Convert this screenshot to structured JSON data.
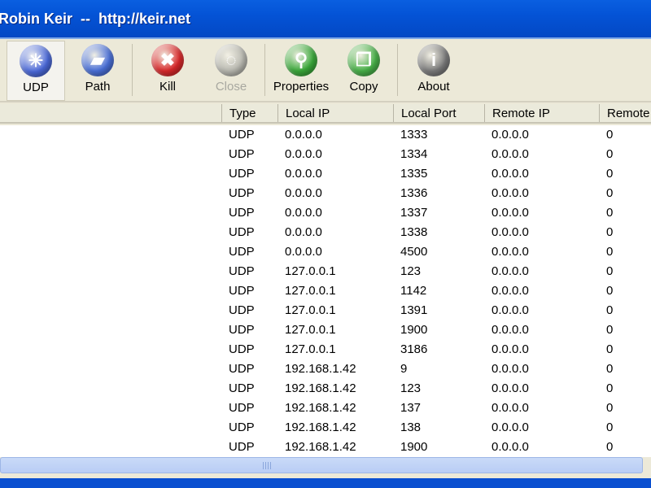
{
  "window": {
    "title": "Robin Keir  --  http://keir.net"
  },
  "toolbar": [
    {
      "label": "UDP",
      "icon": "udp-icon",
      "color": "#4a68d8",
      "state": "active"
    },
    {
      "label": "Path",
      "icon": "folder-icon",
      "color": "#4a70d8",
      "state": "normal"
    },
    {
      "label": "Kill",
      "icon": "kill-x-icon",
      "color": "#d8282a",
      "state": "normal"
    },
    {
      "label": "Close",
      "icon": "close-power-icon",
      "color": "#b8b8b0",
      "state": "disabled"
    },
    {
      "label": "Properties",
      "icon": "magnifier-icon",
      "color": "#3aa83a",
      "state": "normal"
    },
    {
      "label": "Copy",
      "icon": "copy-icon",
      "color": "#48b048",
      "state": "normal"
    },
    {
      "label": "About",
      "icon": "info-icon",
      "color": "#7a7a7a",
      "state": "normal"
    }
  ],
  "columns": [
    "Type",
    "Local IP",
    "Local Port",
    "Remote IP",
    "Remote"
  ],
  "rows": [
    [
      "UDP",
      "0.0.0.0",
      "1333",
      "0.0.0.0",
      "0"
    ],
    [
      "UDP",
      "0.0.0.0",
      "1334",
      "0.0.0.0",
      "0"
    ],
    [
      "UDP",
      "0.0.0.0",
      "1335",
      "0.0.0.0",
      "0"
    ],
    [
      "UDP",
      "0.0.0.0",
      "1336",
      "0.0.0.0",
      "0"
    ],
    [
      "UDP",
      "0.0.0.0",
      "1337",
      "0.0.0.0",
      "0"
    ],
    [
      "UDP",
      "0.0.0.0",
      "1338",
      "0.0.0.0",
      "0"
    ],
    [
      "UDP",
      "0.0.0.0",
      "4500",
      "0.0.0.0",
      "0"
    ],
    [
      "UDP",
      "127.0.0.1",
      "123",
      "0.0.0.0",
      "0"
    ],
    [
      "UDP",
      "127.0.0.1",
      "1142",
      "0.0.0.0",
      "0"
    ],
    [
      "UDP",
      "127.0.0.1",
      "1391",
      "0.0.0.0",
      "0"
    ],
    [
      "UDP",
      "127.0.0.1",
      "1900",
      "0.0.0.0",
      "0"
    ],
    [
      "UDP",
      "127.0.0.1",
      "3186",
      "0.0.0.0",
      "0"
    ],
    [
      "UDP",
      "192.168.1.42",
      "9",
      "0.0.0.0",
      "0"
    ],
    [
      "UDP",
      "192.168.1.42",
      "123",
      "0.0.0.0",
      "0"
    ],
    [
      "UDP",
      "192.168.1.42",
      "137",
      "0.0.0.0",
      "0"
    ],
    [
      "UDP",
      "192.168.1.42",
      "138",
      "0.0.0.0",
      "0"
    ],
    [
      "UDP",
      "192.168.1.42",
      "1900",
      "0.0.0.0",
      "0"
    ]
  ]
}
